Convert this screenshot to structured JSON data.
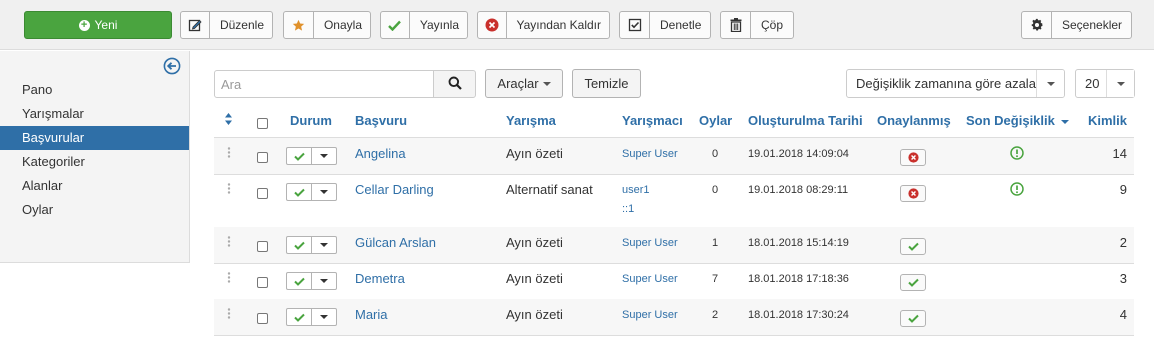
{
  "toolbar": {
    "new_label": "Yeni",
    "edit_label": "Düzenle",
    "approve_label": "Onayla",
    "publish_label": "Yayınla",
    "unpublish_label": "Yayından Kaldır",
    "checkin_label": "Denetle",
    "trash_label": "Çöp",
    "options_label": "Seçenekler"
  },
  "sidebar": {
    "items": [
      {
        "label": "Pano",
        "active": false
      },
      {
        "label": "Yarışmalar",
        "active": false
      },
      {
        "label": "Başvurular",
        "active": true
      },
      {
        "label": "Kategoriler",
        "active": false
      },
      {
        "label": "Alanlar",
        "active": false
      },
      {
        "label": "Oylar",
        "active": false
      }
    ]
  },
  "filters": {
    "search_placeholder": "Ara",
    "tools_label": "Araçlar",
    "clear_label": "Temizle",
    "sort_value": "Değişiklik zamanına göre azalan",
    "limit_value": "20"
  },
  "table": {
    "headers": {
      "status": "Durum",
      "title": "Başvuru",
      "contest": "Yarışma",
      "contestant": "Yarışmacı",
      "votes": "Oylar",
      "created": "Oluşturulma Tarihi",
      "approved": "Onaylanmış",
      "modified": "Son Değişiklik",
      "id": "Kimlik"
    },
    "rows": [
      {
        "title": "Angelina",
        "contest": "Ayın özeti",
        "user": [
          "Super User"
        ],
        "votes": "0",
        "created": "19.01.2018 14:09:04",
        "approved": false,
        "modified_marker": true,
        "id": "14"
      },
      {
        "title": "Cellar Darling",
        "contest": "Alternatif sanat",
        "user": [
          "user1",
          "::1"
        ],
        "votes": "0",
        "created": "19.01.2018 08:29:11",
        "approved": false,
        "modified_marker": true,
        "id": "9"
      },
      {
        "title": "Gülcan Arslan",
        "contest": "Ayın özeti",
        "user": [
          "Super User"
        ],
        "votes": "1",
        "created": "18.01.2018 15:14:19",
        "approved": true,
        "modified_marker": false,
        "id": "2"
      },
      {
        "title": "Demetra",
        "contest": "Ayın özeti",
        "user": [
          "Super User"
        ],
        "votes": "7",
        "created": "18.01.2018 17:18:36",
        "approved": true,
        "modified_marker": false,
        "id": "3"
      },
      {
        "title": "Maria",
        "contest": "Ayın özeti",
        "user": [
          "Super User"
        ],
        "votes": "2",
        "created": "18.01.2018 17:30:24",
        "approved": true,
        "modified_marker": false,
        "id": "4"
      }
    ]
  },
  "colors": {
    "accent": "#2f6fa7",
    "success": "#4aa43f",
    "danger": "#c9302c",
    "toolbar_bg": "#f0f0f0"
  },
  "icons": {
    "new": "plus-circle-icon",
    "edit": "edit-icon",
    "approve": "star-icon",
    "publish": "check-icon",
    "unpublish": "remove-circle-icon",
    "checkin": "checkbox-icon",
    "trash": "trash-icon",
    "options": "gear-icon",
    "collapse": "arrow-left-circle-icon",
    "search": "search-icon",
    "modified": "exclamation-circle-icon"
  }
}
